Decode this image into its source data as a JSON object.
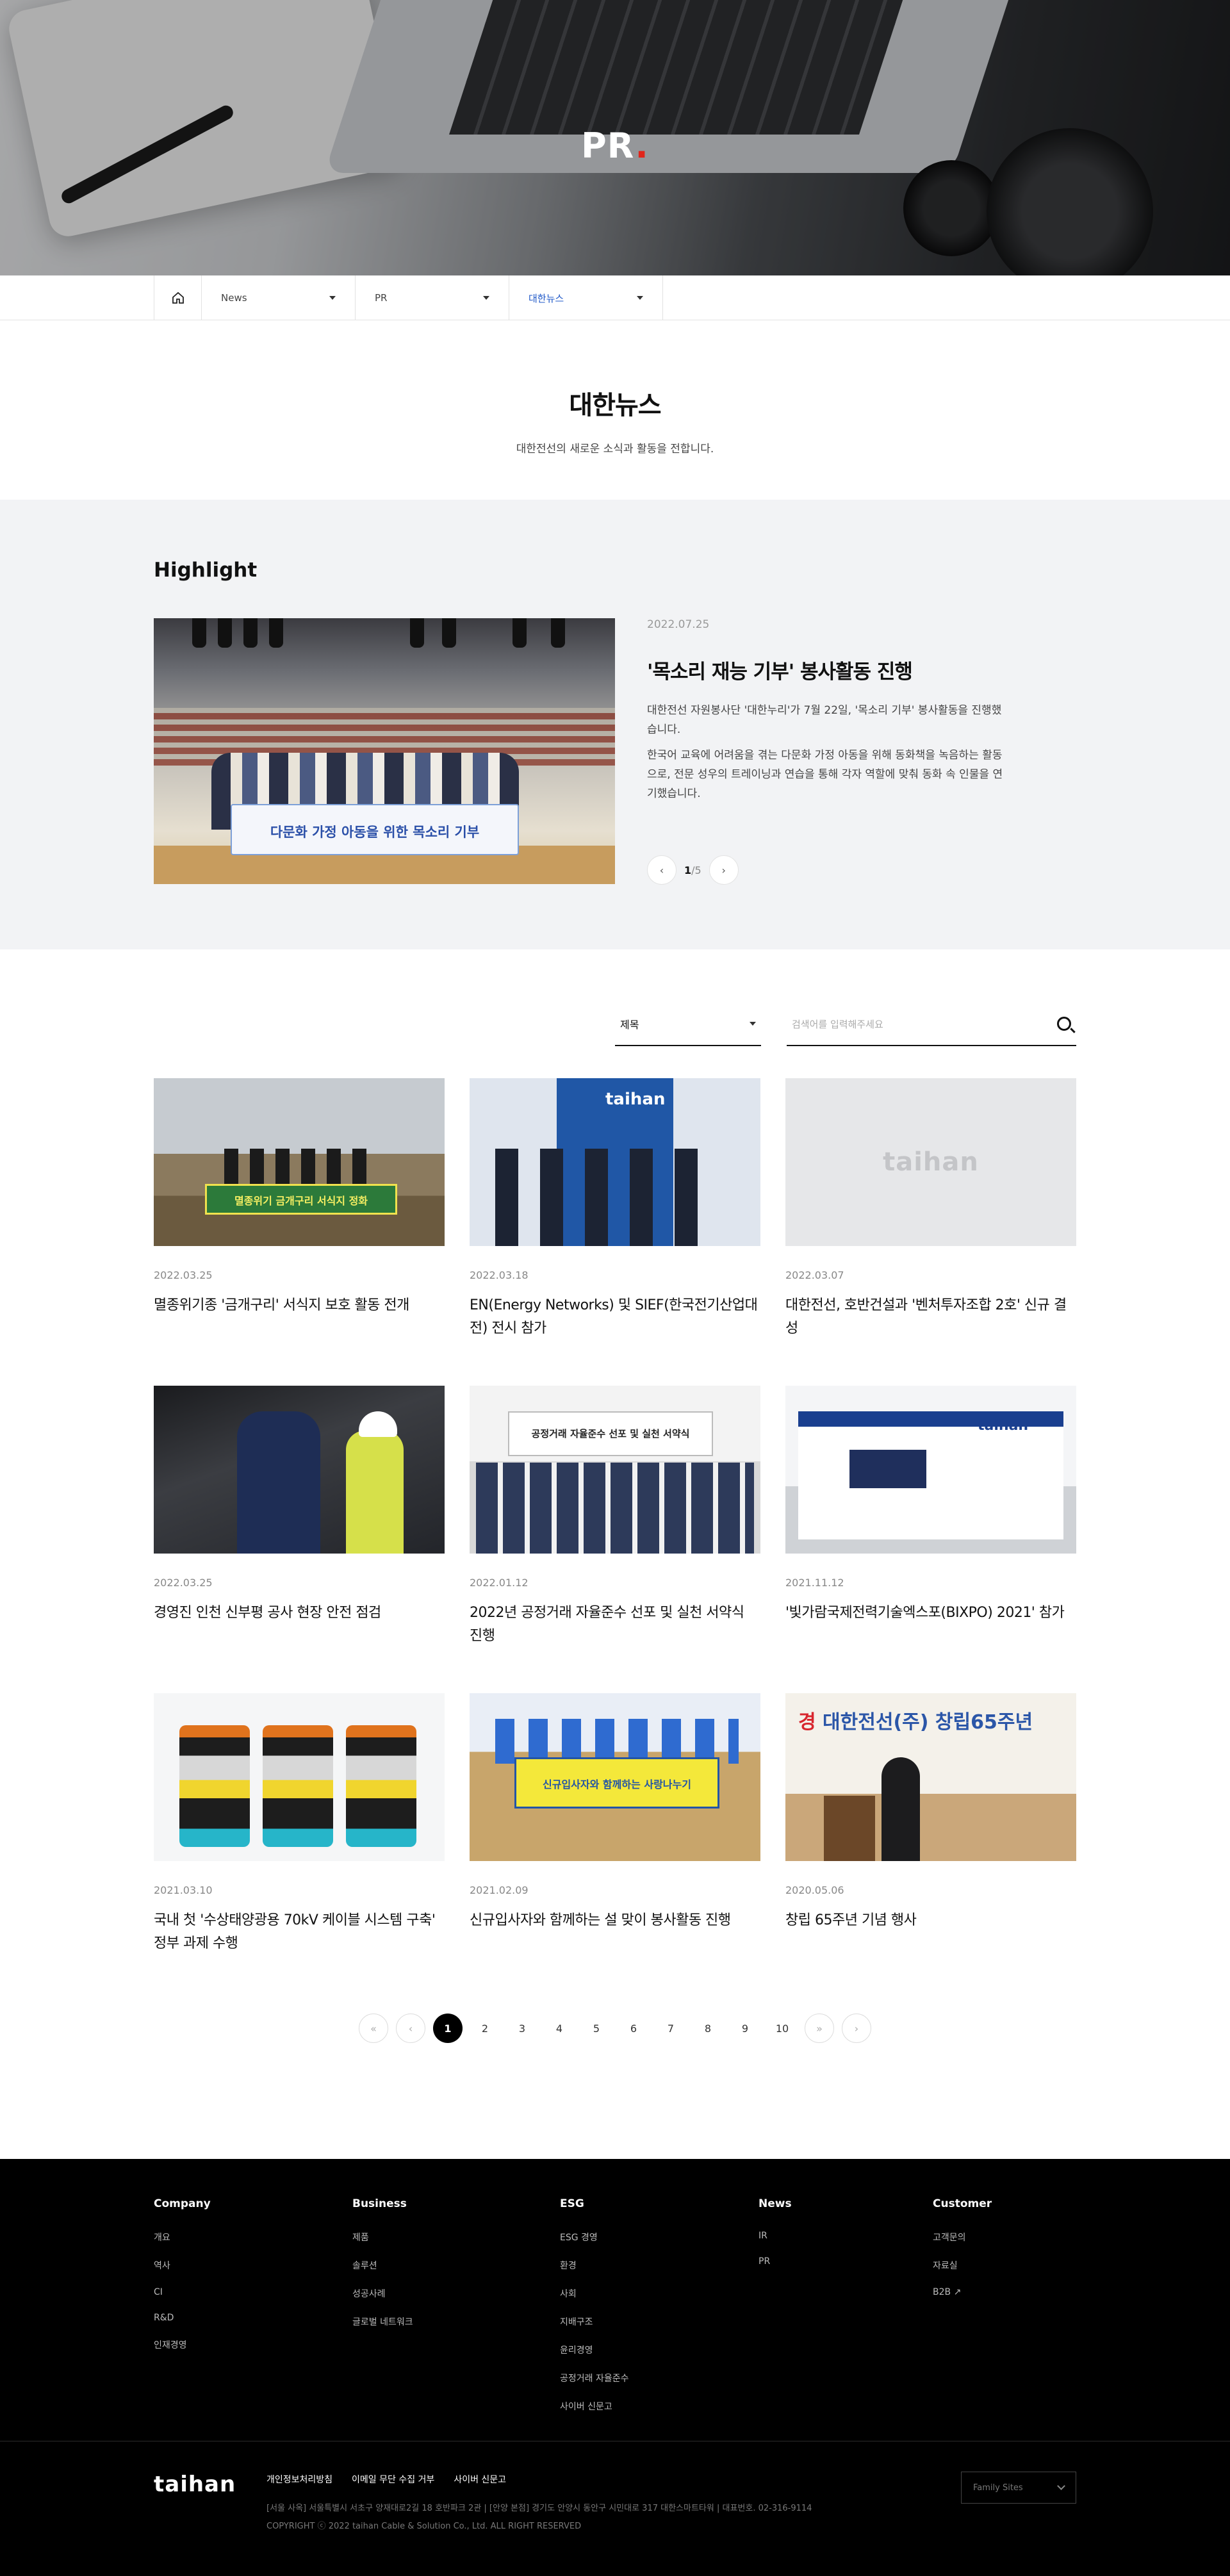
{
  "hero": {
    "title": "PR",
    "dot": "."
  },
  "breadcrumb": {
    "items": [
      "News",
      "PR",
      "대한뉴스"
    ]
  },
  "page": {
    "title": "대한뉴스",
    "subtitle": "대한전선의 새로운 소식과 활동을 전합니다."
  },
  "highlight": {
    "heading": "Highlight",
    "date": "2022.07.25",
    "title": "'목소리 재능 기부' 봉사활동 진행",
    "desc1": "대한전선 자원봉사단 '대한누리'가 7월 22일, '목소리 기부' 봉사활동을 진행했습니다.",
    "desc2": "한국어 교육에 어려움을 겪는 다문화 가정 아동을 위해 동화책을 녹음하는 활동으로, 전문 성우의 트레이닝과 연습을 통해 각자 역할에 맞춰 동화 속 인물을 연기했습니다.",
    "banner": "다문화 가정 아동을 위한 목소리 기부",
    "current": "1",
    "separator": "/",
    "total": "5"
  },
  "search": {
    "select_value": "제목",
    "placeholder": "검색어를 입력해주세요"
  },
  "news": [
    {
      "date": "2022.03.25",
      "title": "멸종위기종 '금개구리' 서식지 보호 활동 전개"
    },
    {
      "date": "2022.03.18",
      "title": "EN(Energy Networks) 및 SIEF(한국전기산업대전) 전시 참가"
    },
    {
      "date": "2022.03.07",
      "title": "대한전선, 호반건설과 '벤처투자조합 2호' 신규 결성"
    },
    {
      "date": "2022.03.25",
      "title": "경영진 인천 신부평 공사 현장 안전 점검"
    },
    {
      "date": "2022.01.12",
      "title": "2022년 공정거래 자율준수 선포 및 실천 서약식 진행"
    },
    {
      "date": "2021.11.12",
      "title": "'빛가람국제전력기술엑스포(BIXPO) 2021' 참가"
    },
    {
      "date": "2021.03.10",
      "title": "국내 첫 '수상태양광용 70kV 케이블 시스템 구축' 정부 과제 수행"
    },
    {
      "date": "2021.02.09",
      "title": "신규입사자와 함께하는 설 맞이 봉사활동 진행"
    },
    {
      "date": "2020.05.06",
      "title": "창립 65주년 기념 행사"
    }
  ],
  "thumbs": {
    "t1_banner": "멸종위기 금개구리 서식지 정화",
    "t2_logo": "taihan",
    "t3_logo": "taihan",
    "t5_sign": "공정거래 자율준수 선포 및 실천 서약식",
    "t6_logo": "taihan",
    "t8_banner": "신규입사자와 함께하는 사랑나누기",
    "t9_banner_a": "경",
    "t9_banner_b": " 대한전선(주) 창립65주년"
  },
  "pagination": {
    "pages": [
      "1",
      "2",
      "3",
      "4",
      "5",
      "6",
      "7",
      "8",
      "9",
      "10"
    ],
    "current": "1"
  },
  "footer": {
    "columns": [
      {
        "title": "Company",
        "items": [
          "개요",
          "역사",
          "CI",
          "R&D",
          "인재경영"
        ]
      },
      {
        "title": "Business",
        "items": [
          "제품",
          "솔루션",
          "성공사례",
          "글로벌 네트워크"
        ]
      },
      {
        "title": "ESG",
        "items": [
          "ESG 경영",
          "환경",
          "사회",
          "지배구조",
          "윤리경영",
          "공정거래 자율준수",
          "사이버 신문고"
        ]
      },
      {
        "title": "News",
        "items": [
          "IR",
          "PR"
        ]
      },
      {
        "title": "Customer",
        "items": [
          "고객문의",
          "자료실",
          "B2B"
        ]
      }
    ],
    "logo": "taihan",
    "links": [
      "개인정보처리방침",
      "이메일 무단 수집 거부",
      "사이버 신문고"
    ],
    "address": "[서울 사옥] 서울특별시 서초구 양재대로2길 18 호반파크 2관   |   [안양 본점] 경기도 안양시 동안구 시민대로 317 대한스마트타워   |   대표번호. 02-316-9114",
    "copyright": "COPYRIGHT ⓒ 2022 taihan Cable & Solution Co., Ltd. ALL RIGHT RESERVED",
    "family_site": "Family Sites"
  }
}
